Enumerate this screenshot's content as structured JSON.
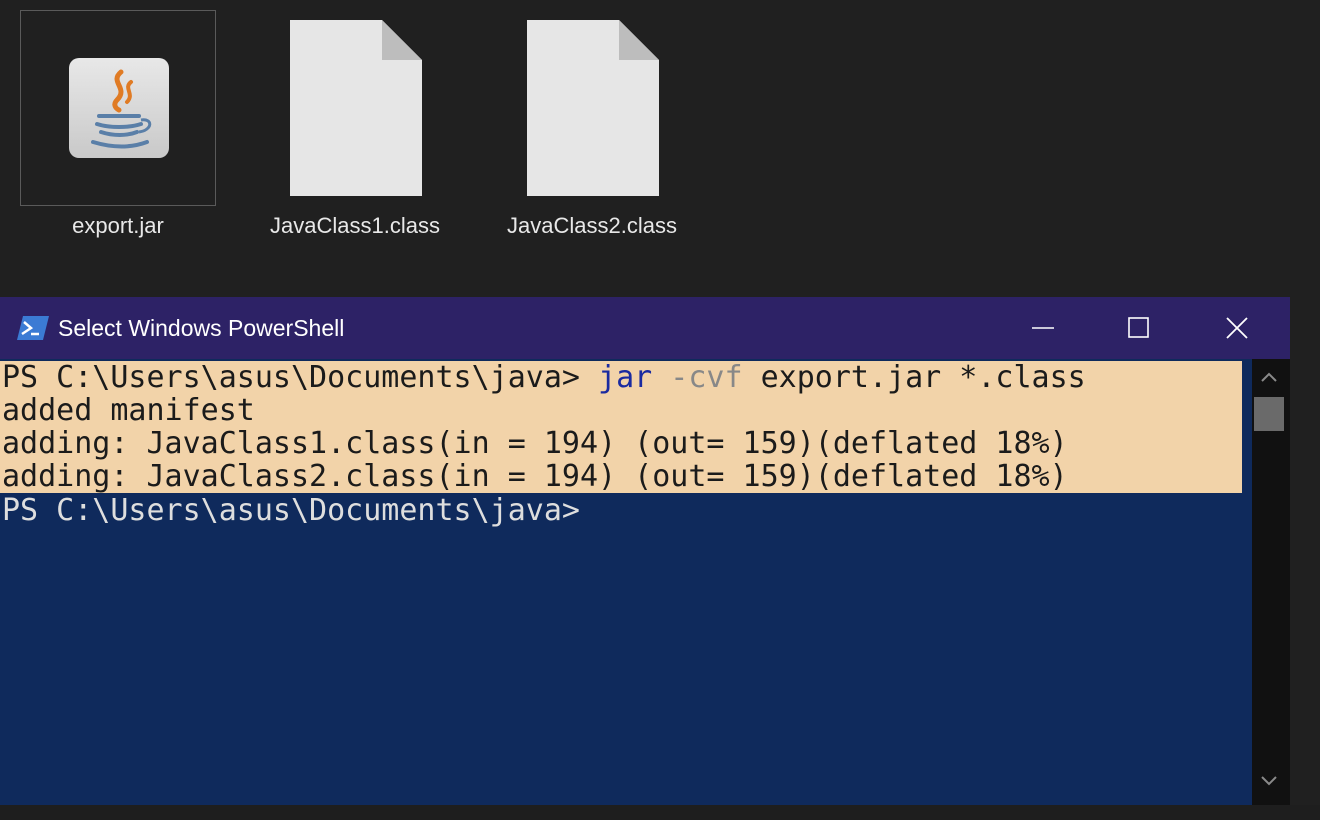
{
  "files": [
    {
      "name": "export.jar",
      "icon": "java-jar-icon",
      "selected": true
    },
    {
      "name": "JavaClass1.class",
      "icon": "class-file-icon",
      "selected": false
    },
    {
      "name": "JavaClass2.class",
      "icon": "class-file-icon",
      "selected": false
    }
  ],
  "powershell": {
    "title": "Select Windows PowerShell",
    "title_bar_color": "#2d2266",
    "background_color": "#0f2a5c",
    "selection_color": "#f2d3a9",
    "lines": [
      {
        "prompt": "PS C:\\Users\\asus\\Documents\\java> ",
        "command": "jar",
        "parameter": " -cvf",
        "arguments": " export.jar *.class",
        "selected": true
      },
      {
        "text": "added manifest",
        "selected": true
      },
      {
        "text": "adding: JavaClass1.class(in = 194) (out= 159)(deflated 18%)",
        "selected": true
      },
      {
        "text": "adding: JavaClass2.class(in = 194) (out= 159)(deflated 18%)",
        "selected": true
      },
      {
        "text": "PS C:\\Users\\asus\\Documents\\java>",
        "selected": false
      }
    ],
    "window_buttons": [
      "minimize-icon",
      "maximize-icon",
      "close-icon"
    ]
  }
}
